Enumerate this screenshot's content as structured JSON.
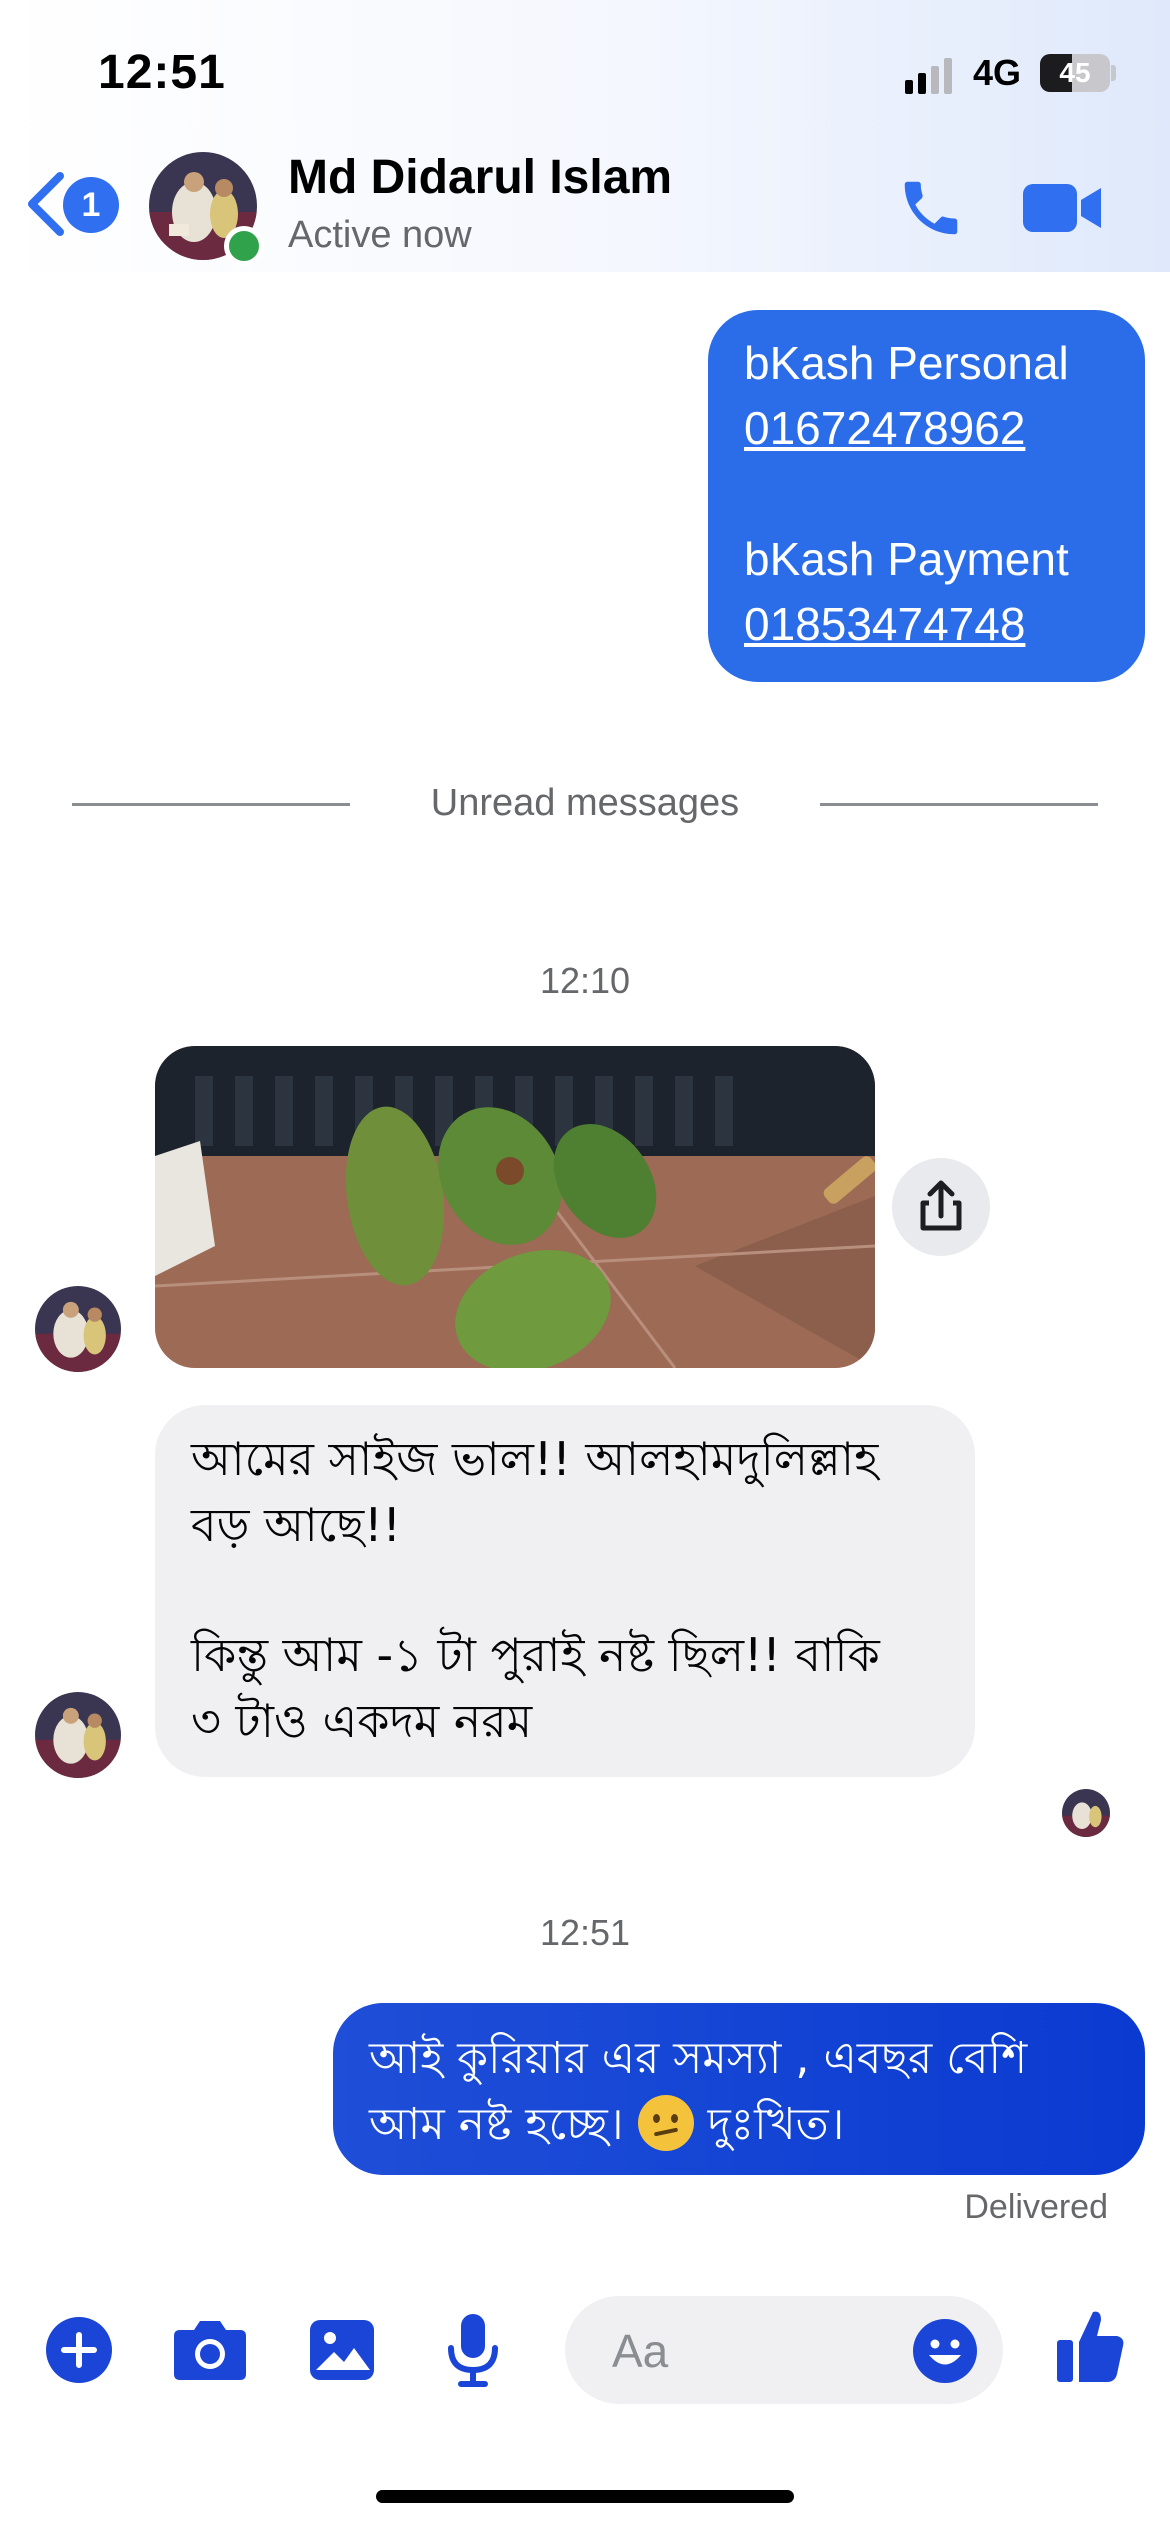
{
  "status_bar": {
    "time": "12:51",
    "network": "4G",
    "battery": "45",
    "battery_level": 0.45
  },
  "header": {
    "back_badge": "1",
    "contact_name": "Md Didarul Islam",
    "contact_status": "Active now",
    "icons": [
      "back-chevron-icon",
      "phone-call-icon",
      "video-call-icon"
    ]
  },
  "messages": {
    "outgoing_1": {
      "line1": "bKash Personal",
      "line2": "01672478962",
      "line3": "bKash Payment",
      "line4": "01853474748"
    },
    "divider_label": "Unread messages",
    "timestamp_1": "12:10",
    "incoming_text": {
      "line1": "আমের সাইজ ভাল!!  আলহামদুলিল্লাহ",
      "line2": "বড় আছে!!",
      "line3": "কিন্তু আম -১ টা পুরাই নষ্ট ছিল!!  বাকি",
      "line4": "৩ টাও একদম নরম"
    },
    "timestamp_2": "12:51",
    "outgoing_2": {
      "line1": "আই কুরিয়ার এর সমস্যা , এবছর বেশি",
      "line2a": "আম নষ্ট হচ্ছে।",
      "line2b": "দুঃখিত।"
    },
    "delivered_label": "Delivered"
  },
  "composer": {
    "placeholder": "Aa",
    "icons": [
      "plus-icon",
      "camera-icon",
      "gallery-icon",
      "microphone-icon",
      "emoji-icon",
      "thumbs-up-icon"
    ]
  },
  "colors": {
    "accent": "#2b6de9",
    "outgoing_bubble": "#2b6de9",
    "incoming_bubble": "#f0f0f2",
    "online": "#31a24c"
  }
}
